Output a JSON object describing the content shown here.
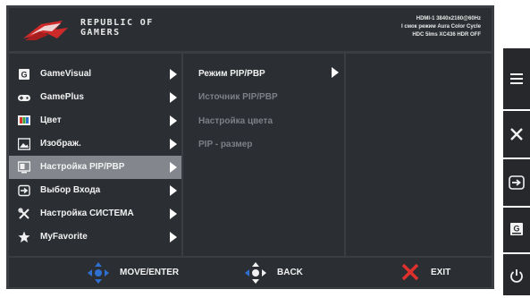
{
  "header": {
    "brand_line1": "REPUBLIC OF",
    "brand_line2": "GAMERS",
    "info_line1": "HDMI-1 3840x2160@60Hz",
    "info_line2": "I смок режим Aura Color Cycle",
    "info_line3": "HDC 5lms XC436 HDR OFF"
  },
  "menu": {
    "items": [
      {
        "label": "GameVisual",
        "icon": "gamevisual-icon"
      },
      {
        "label": "GamePlus",
        "icon": "gamepad-icon"
      },
      {
        "label": "Цвет",
        "icon": "color-icon"
      },
      {
        "label": "Изображ.",
        "icon": "image-icon"
      },
      {
        "label": "Настройка PIP/PBP",
        "icon": "pip-icon",
        "selected": true
      },
      {
        "label": "Выбор Входа",
        "icon": "input-icon"
      },
      {
        "label": "Настройка СИСТЕМА",
        "icon": "tools-icon"
      },
      {
        "label": "MyFavorite",
        "icon": "star-icon"
      }
    ]
  },
  "submenu": {
    "items": [
      {
        "label": "Режим PIP/PBP",
        "enabled": true
      },
      {
        "label": "Источник PIP/PBP",
        "enabled": false
      },
      {
        "label": "Настройка цвета",
        "enabled": false
      },
      {
        "label": "PIP - размер",
        "enabled": false
      }
    ]
  },
  "footer": {
    "move_label": "MOVE/ENTER",
    "back_label": "BACK",
    "exit_label": "EXIT"
  },
  "side_buttons": [
    "menu-icon",
    "close-icon",
    "input-icon",
    "gamevisual-icon",
    "power-icon"
  ],
  "colors": {
    "selection": "#83878d",
    "accent_blue": "#2f6fd0",
    "exit_red": "#e0302c"
  }
}
